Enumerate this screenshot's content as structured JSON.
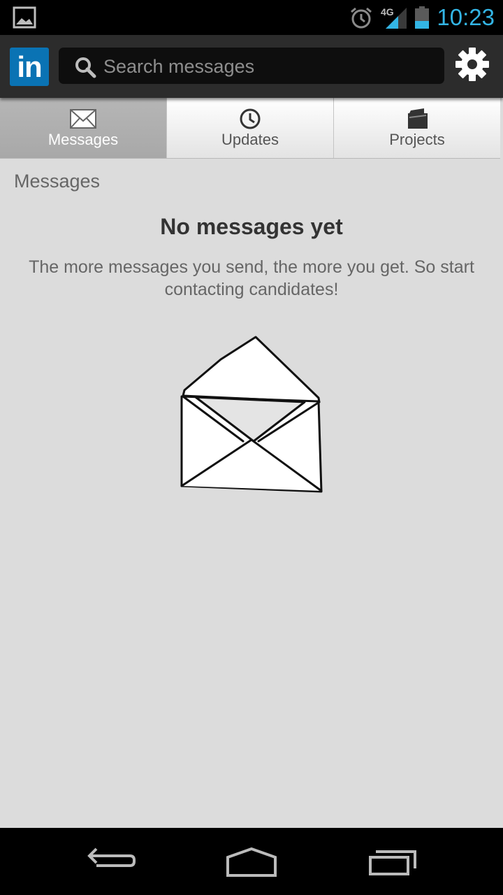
{
  "status_bar": {
    "time": "10:23",
    "network_label": "4G",
    "icons": [
      "gallery-icon",
      "alarm-icon",
      "signal-icon",
      "battery-icon"
    ],
    "clock_color": "#33b5e5"
  },
  "app_bar": {
    "logo_text": "in",
    "logo_color": "#0a73b4",
    "search_placeholder": "Search messages",
    "settings_icon": "gear-icon"
  },
  "tabs": [
    {
      "label": "Messages",
      "icon": "envelope-icon",
      "active": true
    },
    {
      "label": "Updates",
      "icon": "clock-icon",
      "active": false
    },
    {
      "label": "Projects",
      "icon": "folder-icon",
      "active": false
    }
  ],
  "content": {
    "section_title": "Messages",
    "empty_title": "No messages yet",
    "empty_description": "The more messages you send, the more you get. So start contacting candidates!",
    "illustration": "open-envelope-icon"
  },
  "nav_bar": {
    "buttons": [
      "back-icon",
      "home-icon",
      "recent-apps-icon"
    ]
  }
}
